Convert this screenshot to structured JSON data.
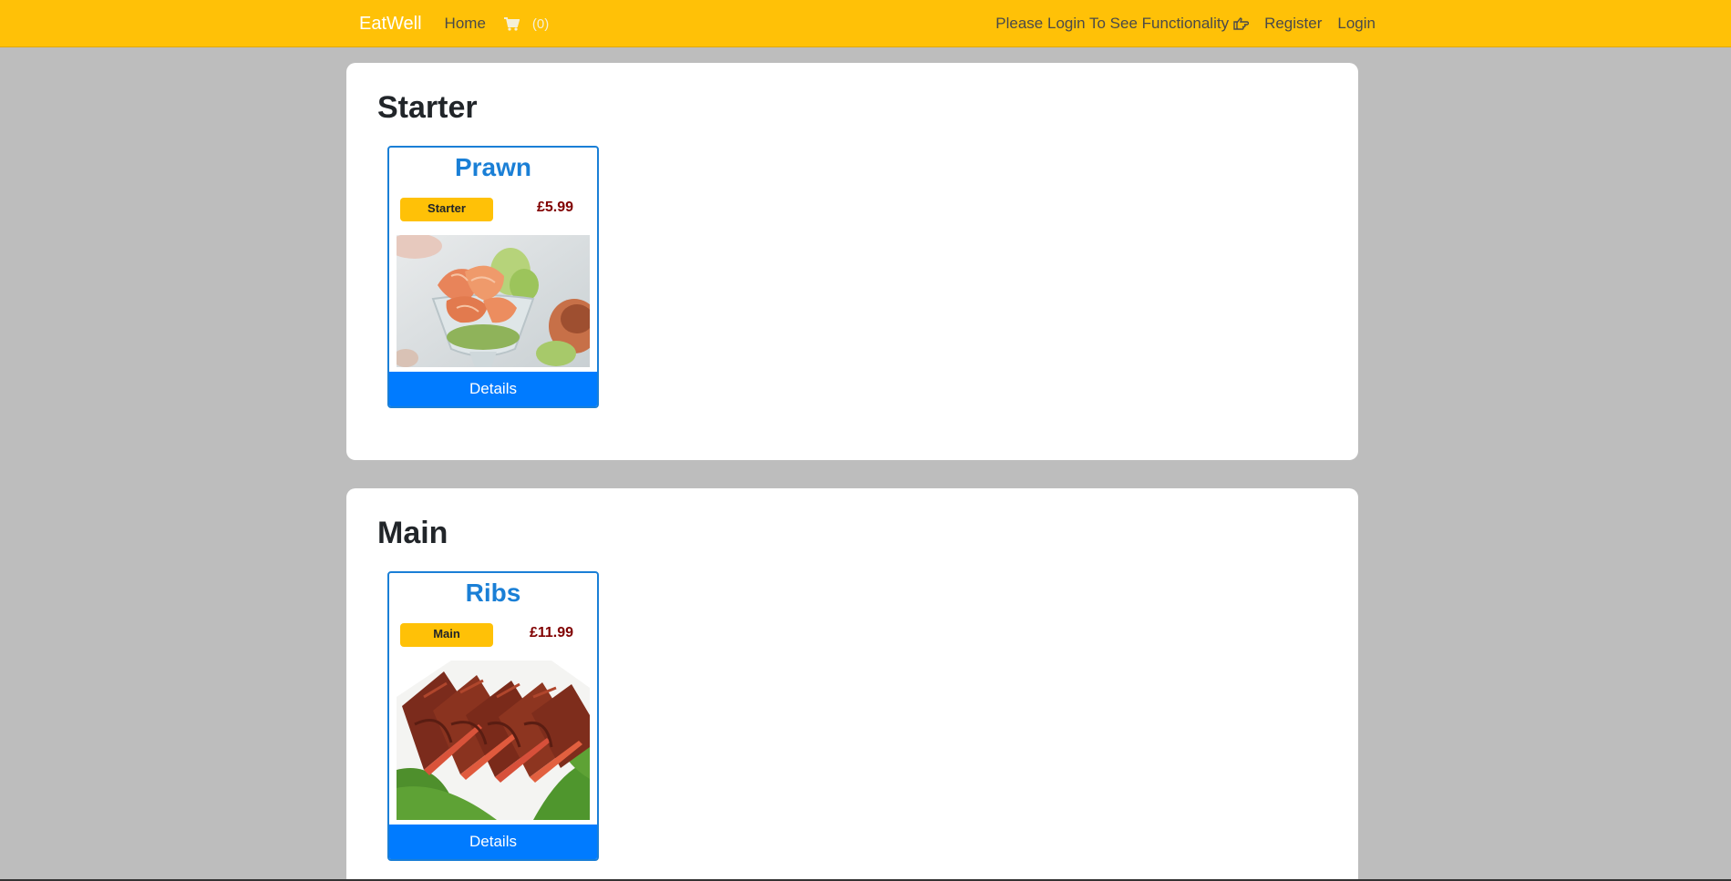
{
  "navbar": {
    "brand": "EatWell",
    "home_label": "Home",
    "cart_count": "(0)",
    "login_message": "Please Login To See Functionality",
    "register_label": "Register",
    "login_label": "Login",
    "cart_icon": "shopping-cart-icon",
    "pointer_icon": "hand-point-right-icon"
  },
  "sections": [
    {
      "title": "Starter",
      "items": [
        {
          "name": "Prawn",
          "category": "Starter",
          "price": "£5.99",
          "button_label": "Details",
          "image": "prawn-cocktail-photo"
        }
      ]
    },
    {
      "title": "Main",
      "items": [
        {
          "name": "Ribs",
          "category": "Main",
          "price": "£11.99",
          "button_label": "Details",
          "image": "bbq-ribs-photo"
        }
      ]
    }
  ],
  "colors": {
    "navbar_bg": "#ffc107",
    "page_bg": "#bdbdbd",
    "accent_blue": "#007bff",
    "price_color": "#800000"
  }
}
